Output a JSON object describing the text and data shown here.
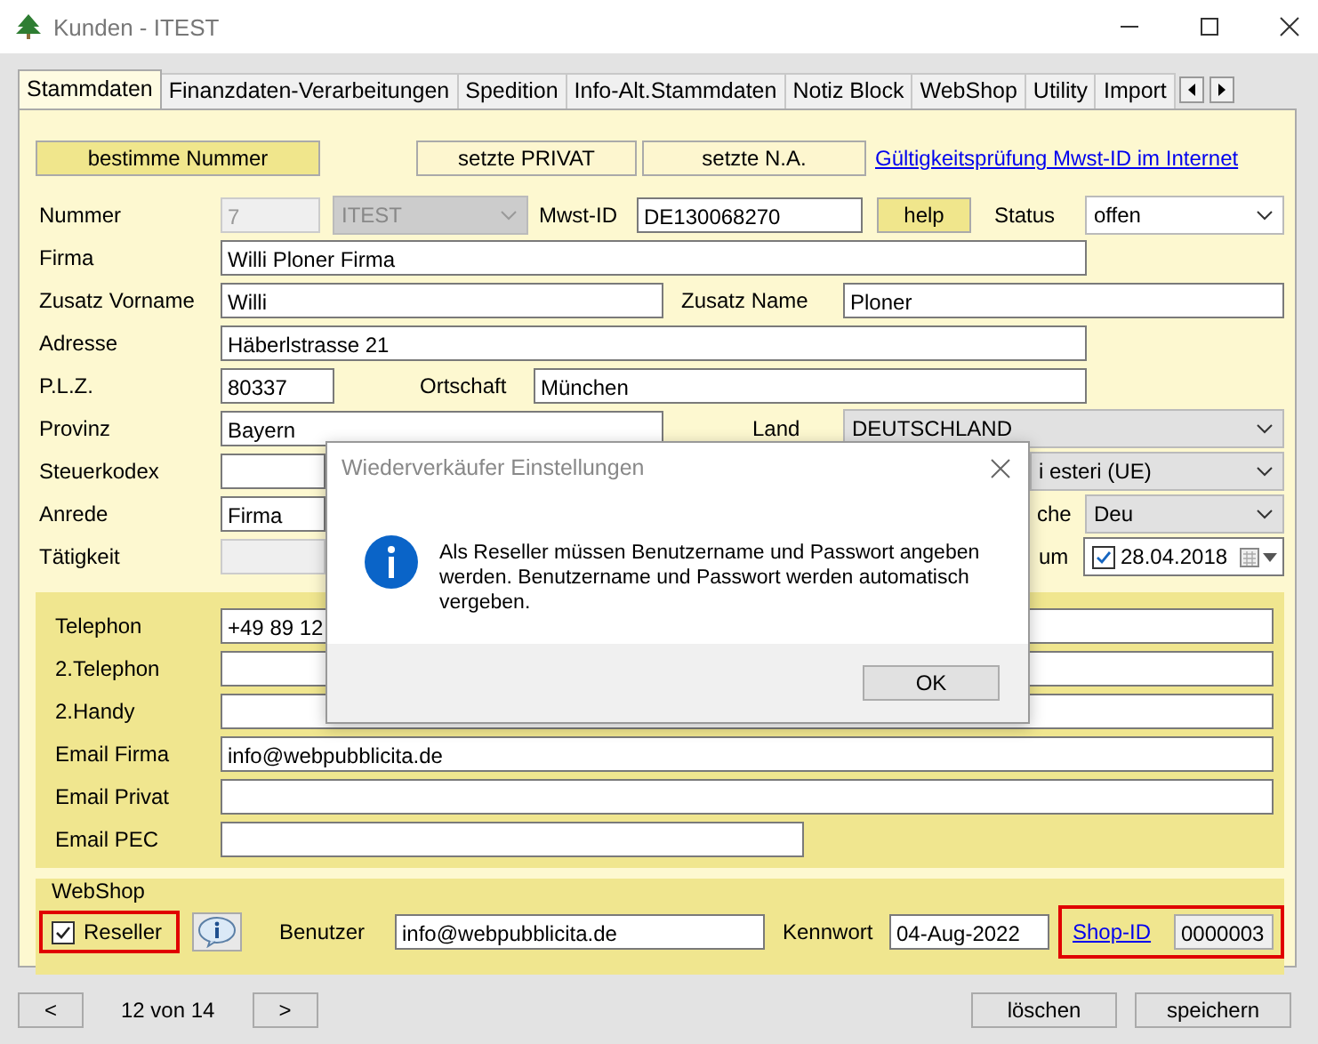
{
  "window": {
    "title": "Kunden - ITEST"
  },
  "tabs": [
    {
      "label": "Stammdaten",
      "selected": true
    },
    {
      "label": "Finanzdaten-Verarbeitungen",
      "selected": false
    },
    {
      "label": "Spedition",
      "selected": false
    },
    {
      "label": "Info-Alt.Stammdaten",
      "selected": false
    },
    {
      "label": "Notiz Block",
      "selected": false
    },
    {
      "label": "WebShop",
      "selected": false
    },
    {
      "label": "Utility",
      "selected": false
    },
    {
      "label": "Import",
      "selected": false
    }
  ],
  "actions": {
    "buttons": [
      "bestimme Nummer",
      "setzte PRIVAT",
      "setzte N.A."
    ],
    "link": "Gültigkeitsprüfung Mwst-ID im Internet"
  },
  "nummer": {
    "label": "Nummer",
    "value": "7",
    "code": "ITEST",
    "disabled": true
  },
  "mwst": {
    "label": "Mwst-ID",
    "value": "DE130068270",
    "button": "help"
  },
  "status": {
    "label": "Status",
    "value": "offen"
  },
  "firma": {
    "label": "Firma",
    "value": "Willi Ploner Firma"
  },
  "vorname": {
    "label": "Zusatz Vorname",
    "value": "Willi"
  },
  "name": {
    "label": "Zusatz Name",
    "value": "Ploner"
  },
  "adresse": {
    "label": "Adresse",
    "value": "Häberlstrasse 21"
  },
  "plz": {
    "label": "P.L.Z.",
    "value": "80337"
  },
  "ortschaft": {
    "label": "Ortschaft",
    "value": "München"
  },
  "provinz": {
    "label": "Provinz",
    "value": "Bayern"
  },
  "land": {
    "label": "Land",
    "value": "DEUTSCHLAND"
  },
  "steuerkodex": {
    "label": "Steuerkodex",
    "option": "i esteri (UE)"
  },
  "anrede": {
    "label": "Anrede",
    "value": "Firma"
  },
  "sprache": {
    "label": "che",
    "value": "Deu"
  },
  "taetigkeit": {
    "label": "Tätigkeit",
    "disabled": true
  },
  "datum": {
    "label": "um",
    "value": "28.04.2018",
    "checked": true
  },
  "contacts": [
    {
      "label": "Telephon",
      "value": "+49 89 12"
    },
    {
      "label": "2.Telephon"
    },
    {
      "label": "2.Handy"
    },
    {
      "label": "Email Firma",
      "value": "info@webpubblicita.de"
    },
    {
      "label": "Email Privat"
    },
    {
      "label": "Email PEC"
    }
  ],
  "webshop": {
    "title": "WebShop",
    "reseller": {
      "label": "Reseller",
      "checked": true
    },
    "benutzer": {
      "label": "Benutzer",
      "value": "info@webpubblicita.de"
    },
    "kennwort": {
      "label": "Kennwort",
      "value": "04-Aug-2022"
    },
    "shop_id": {
      "label": "Shop-ID",
      "value": "0000003"
    }
  },
  "navigation": {
    "prev": "<",
    "position": "12 von 14",
    "next": ">"
  },
  "footer_buttons": [
    "löschen",
    "speichern"
  ],
  "dialog": {
    "title": "Wiederverkäufer Einstellungen",
    "message": "Als Reseller müssen Benutzername und Passwort angeben werden. Benutzername und Passwort werden automatisch vergeben.",
    "button": "OK"
  }
}
